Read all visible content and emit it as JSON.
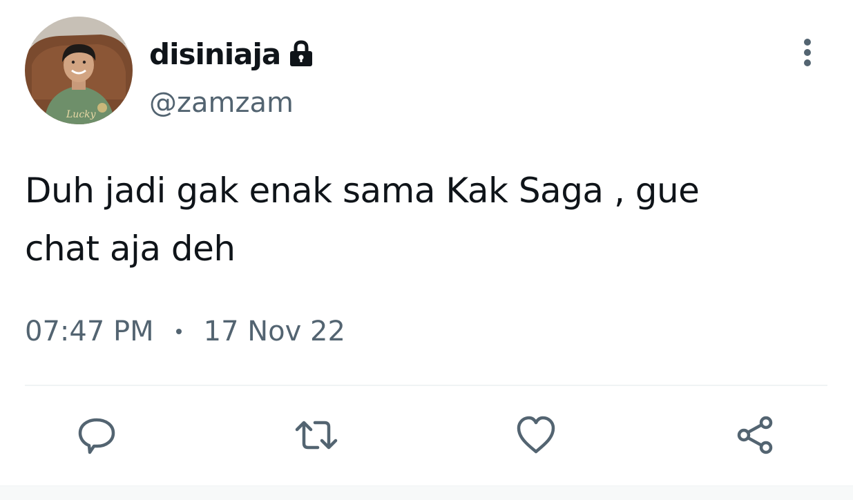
{
  "user": {
    "display_name": "disiniaja",
    "handle": "@zamzam",
    "avatar_shirt_text": "Lucky",
    "lock_icon": "lock-icon"
  },
  "tweet": {
    "text_line1": "Duh jadi gak enak sama Kak Saga , gue",
    "text_line2": "chat aja deh",
    "time": "07:47 PM",
    "date": "17 Nov 22"
  },
  "actions": {
    "reply_icon": "reply-icon",
    "retweet_icon": "retweet-icon",
    "like_icon": "heart-icon",
    "share_icon": "share-icon",
    "more_icon": "more-vertical-icon"
  },
  "colors": {
    "text_primary": "#0f1419",
    "text_secondary": "#536471",
    "divider": "#eff3f4"
  }
}
